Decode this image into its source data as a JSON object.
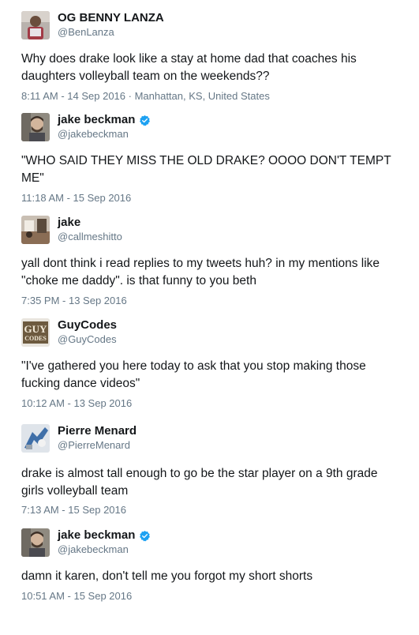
{
  "tweets": [
    {
      "name": "OG BENNY LANZA",
      "handle": "@BenLanza",
      "verified": false,
      "text": "Why does drake look like a stay at home dad that coaches his daughters volleyball team on the weekends??",
      "meta": "8:11 AM - 14 Sep 2016 · Manhattan, KS, United States",
      "avatar_icon": "user-avatar-icon"
    },
    {
      "name": "jake beckman",
      "handle": "@jakebeckman",
      "verified": true,
      "text": "\"WHO SAID THEY MISS THE OLD DRAKE? OOOO DON'T TEMPT ME\"",
      "meta": "11:18 AM - 15 Sep 2016",
      "avatar_icon": "user-avatar-icon"
    },
    {
      "name": "jake",
      "handle": "@callmeshitto",
      "verified": false,
      "text": "yall dont think i read replies to my tweets huh? in my mentions like \"choke me daddy\". is that funny to you beth",
      "meta": "7:35 PM - 13 Sep 2016",
      "avatar_icon": "user-avatar-icon"
    },
    {
      "name": "GuyCodes",
      "handle": "@GuyCodes",
      "verified": false,
      "text": "\"I've gathered you here today to ask that you stop making those fucking dance videos\"",
      "meta": "10:12 AM - 13 Sep 2016",
      "avatar_icon": "guy-codes-logo",
      "avatar_logo_text": "GUY CODES"
    },
    {
      "name": "Pierre Menard",
      "handle": "@PierreMenard",
      "verified": false,
      "text": "drake is almost tall enough to go be the star player on a 9th grade girls volleyball team",
      "meta": "7:13 AM - 15 Sep 2016",
      "avatar_icon": "user-avatar-icon"
    },
    {
      "name": "jake beckman",
      "handle": "@jakebeckman",
      "verified": true,
      "text": "damn it karen, don't tell me you forgot my short shorts",
      "meta": "10:51 AM - 15 Sep 2016",
      "avatar_icon": "user-avatar-icon"
    }
  ],
  "colors": {
    "text": "#14171a",
    "secondary": "#657786",
    "verified_blue": "#1da1f2"
  }
}
